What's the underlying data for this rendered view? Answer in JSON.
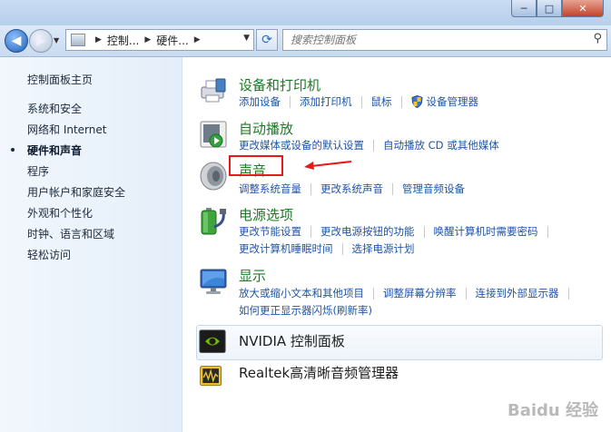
{
  "window": {
    "min_label": "─",
    "max_label": "□",
    "close_label": "✕"
  },
  "address": {
    "crumbs": [
      "控制...",
      "硬件..."
    ]
  },
  "search": {
    "placeholder": "搜索控制面板"
  },
  "sidebar": {
    "items": [
      {
        "label": "控制面板主页"
      },
      {
        "label": "系统和安全"
      },
      {
        "label": "网络和 Internet"
      },
      {
        "label": "硬件和声音",
        "active": true
      },
      {
        "label": "程序"
      },
      {
        "label": "用户帐户和家庭安全"
      },
      {
        "label": "外观和个性化"
      },
      {
        "label": "时钟、语言和区域"
      },
      {
        "label": "轻松访问"
      }
    ]
  },
  "categories": {
    "devices": {
      "title": "设备和打印机",
      "links": [
        "添加设备",
        "添加打印机",
        "鼠标",
        "设备管理器"
      ]
    },
    "autoplay": {
      "title": "自动播放",
      "links": [
        "更改媒体或设备的默认设置",
        "自动播放 CD 或其他媒体"
      ]
    },
    "sound": {
      "title": "声音",
      "links": [
        "调整系统音量",
        "更改系统声音",
        "管理音频设备"
      ]
    },
    "power": {
      "title": "电源选项",
      "links_row1": [
        "更改节能设置",
        "更改电源按钮的功能",
        "唤醒计算机时需要密码"
      ],
      "links_row2": [
        "更改计算机睡眠时间",
        "选择电源计划"
      ]
    },
    "display": {
      "title": "显示",
      "links_row1": [
        "放大或缩小文本和其他项目",
        "调整屏幕分辨率",
        "连接到外部显示器"
      ],
      "links_row2": [
        "如何更正显示器闪烁(刷新率)"
      ]
    },
    "nvidia": {
      "title": "NVIDIA 控制面板"
    },
    "realtek": {
      "title": "Realtek高清晰音频管理器"
    }
  },
  "watermark": "Baidu 经验",
  "colors": {
    "category_title": "#1c7a25",
    "link": "#1d55a8",
    "highlight": "#e41b1b"
  }
}
